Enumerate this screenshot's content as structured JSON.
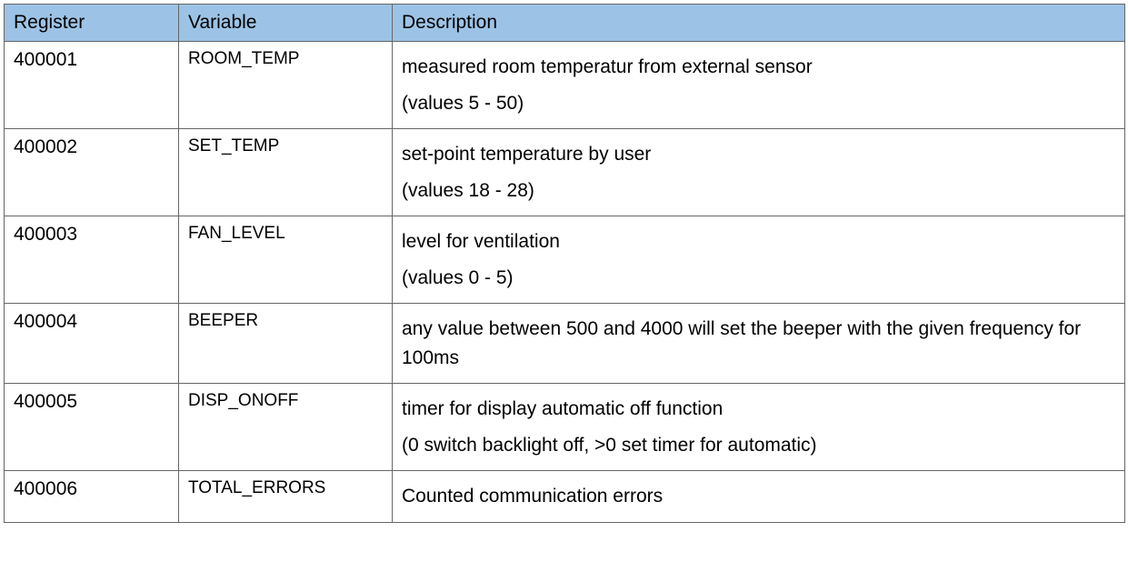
{
  "headers": {
    "register": "Register",
    "variable": "Variable",
    "description": "Description"
  },
  "rows": [
    {
      "register": "400001",
      "variable": "ROOM_TEMP",
      "desc1": "measured room temperatur from external sensor",
      "desc2": "(values 5 - 50)"
    },
    {
      "register": "400002",
      "variable": "SET_TEMP",
      "desc1": "set-point temperature by user",
      "desc2": "(values 18 - 28)"
    },
    {
      "register": "400003",
      "variable": "FAN_LEVEL",
      "desc1": "level for ventilation",
      "desc2": "(values 0 - 5)"
    },
    {
      "register": "400004",
      "variable": "BEEPER",
      "desc1": "any value between 500 and 4000 will set the beeper with the given frequency for 100ms",
      "desc2": ""
    },
    {
      "register": "400005",
      "variable": "DISP_ONOFF",
      "desc1": "timer for display automatic off function",
      "desc2": "(0 switch backlight off, >0 set timer for automatic)"
    },
    {
      "register": "400006",
      "variable": "TOTAL_ERRORS",
      "desc1": "Counted communication errors",
      "desc2": ""
    }
  ]
}
